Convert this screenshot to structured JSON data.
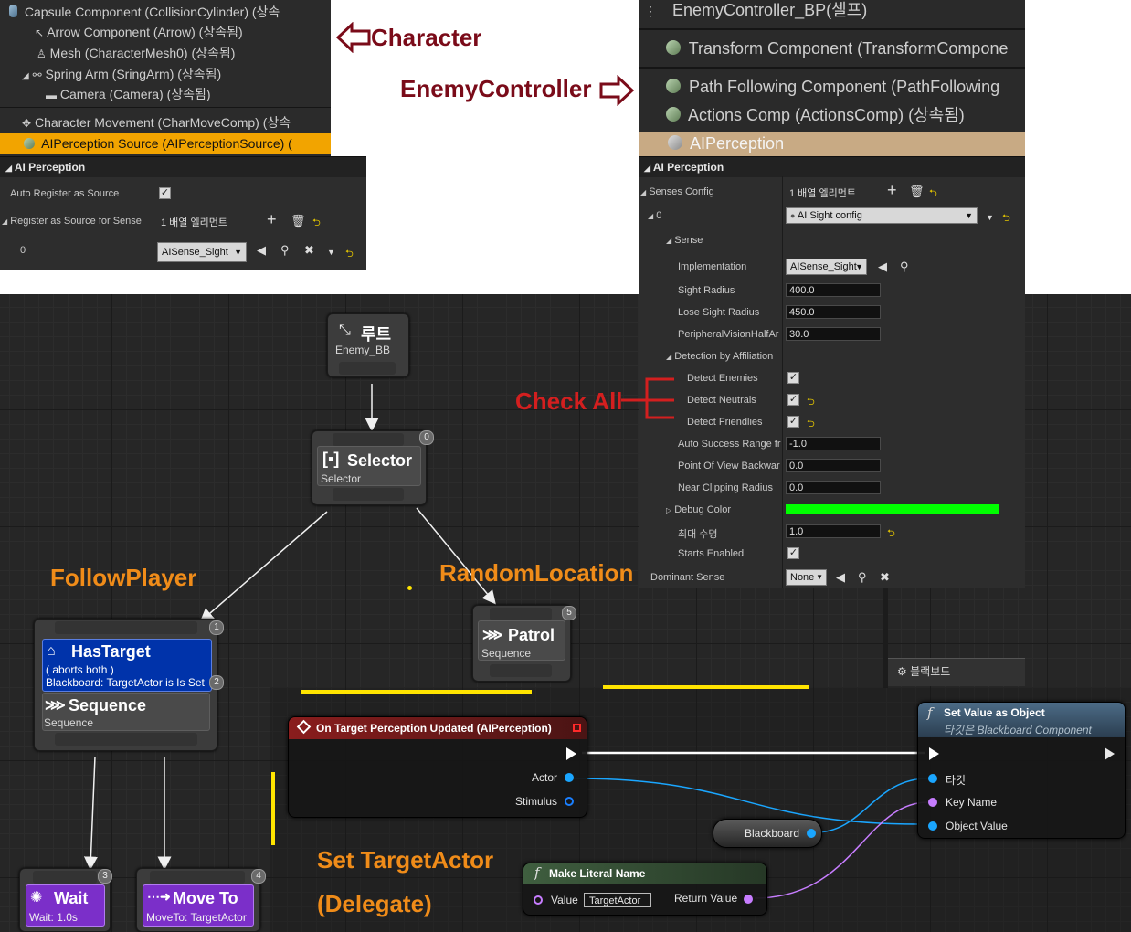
{
  "annotations": {
    "character": "Character",
    "enemy_controller": "EnemyController",
    "check_all": "Check All",
    "follow_player": "FollowPlayer",
    "random_location": "RandomLocation",
    "set_target_actor": "Set TargetActor",
    "delegate": "(Delegate)"
  },
  "character_panel": {
    "components": [
      "Capsule Component (CollisionCylinder) (상속",
      "Arrow Component (Arrow) (상속됨)",
      "Mesh (CharacterMesh0) (상속됨)",
      "Spring Arm (SringArm) (상속됨)",
      "Camera (Camera) (상속됨)",
      "Character Movement (CharMoveComp) (상속",
      "AIPerception Source (AIPerceptionSource) ("
    ],
    "section": "AI Perception",
    "auto_register_label": "Auto Register as Source",
    "register_label": "Register as Source for Sense",
    "array_text": "1 배열 엘리먼트",
    "index_label": "0",
    "sense_value": "AISense_Sight"
  },
  "controller_panel": {
    "components": [
      "EnemyController_BP(셀프)",
      "Transform Component (TransformCompone",
      "Path Following Component (PathFollowing",
      "Actions Comp (ActionsComp) (상속됨)",
      "AIPerception"
    ],
    "section": "AI Perception",
    "senses_config_label": "Senses Config",
    "array_text": "1 배열 엘리먼트",
    "index_label": "0",
    "config_value": "AI Sight config",
    "sense_label": "Sense",
    "implementation_label": "Implementation",
    "implementation_value": "AISense_Sight",
    "sight_radius_label": "Sight Radius",
    "sight_radius_value": "400.0",
    "lose_sight_label": "Lose Sight Radius",
    "lose_sight_value": "450.0",
    "peripheral_label": "PeripheralVisionHalfAr",
    "peripheral_value": "30.0",
    "affiliation_label": "Detection by Affiliation",
    "detect_enemies_label": "Detect Enemies",
    "detect_neutrals_label": "Detect Neutrals",
    "detect_friendlies_label": "Detect Friendlies",
    "auto_success_label": "Auto Success Range fr",
    "auto_success_value": "-1.0",
    "pov_backward_label": "Point Of View Backwar",
    "pov_backward_value": "0.0",
    "near_clip_label": "Near Clipping Radius",
    "near_clip_value": "0.0",
    "debug_color_label": "Debug Color",
    "debug_color": "#00ff00",
    "max_age_label": "최대 수명",
    "max_age_value": "1.0",
    "starts_enabled_label": "Starts Enabled",
    "dominant_sense_label": "Dominant Sense",
    "dominant_sense_value": "None",
    "blackboard_tab": "블랙보드"
  },
  "behavior_tree": {
    "root_title": "루트",
    "root_sub": "Enemy_BB",
    "selector_title": "Selector",
    "selector_sub": "Selector",
    "selector_index": "0",
    "hastarget_title": "HasTarget",
    "hastarget_line1": "( aborts both )",
    "hastarget_line2": "Blackboard: TargetActor is Is Set",
    "hastarget_index": "2",
    "seq1_title": "Sequence",
    "seq1_sub": "Sequence",
    "seq1_index": "1",
    "patrol_title": "Patrol",
    "patrol_sub": "Sequence",
    "patrol_index": "5",
    "wait_title": "Wait",
    "wait_sub": "Wait: 1.0s",
    "wait_index": "3",
    "moveto_title": "Move To",
    "moveto_sub": "MoveTo: TargetActor",
    "moveto_index": "4"
  },
  "blueprint": {
    "event_title": "On Target Perception Updated (AIPerception)",
    "actor_pin": "Actor",
    "stimulus_pin": "Stimulus",
    "setvalue_title": "Set Value as Object",
    "setvalue_sub": "타깃은 Blackboard Component",
    "target_pin": "타깃",
    "keyname_pin": "Key Name",
    "objvalue_pin": "Object Value",
    "blackboard_var": "Blackboard",
    "literal_title": "Make Literal Name",
    "value_pin": "Value",
    "value_text": "TargetActor",
    "return_pin": "Return Value"
  },
  "colors": {
    "selected_row": "#f2a400",
    "controller_selected": "#c8aa84",
    "hastarget_blue": "#0033aa",
    "task_purple": "#7b2fc9",
    "event_red": "#7a1a1a",
    "function_blue": "#35526e",
    "function_green": "#2f4a2f",
    "yellow_line": "#ffe400",
    "object_pin": "#1aa6ff",
    "name_pin": "#c77dff"
  }
}
